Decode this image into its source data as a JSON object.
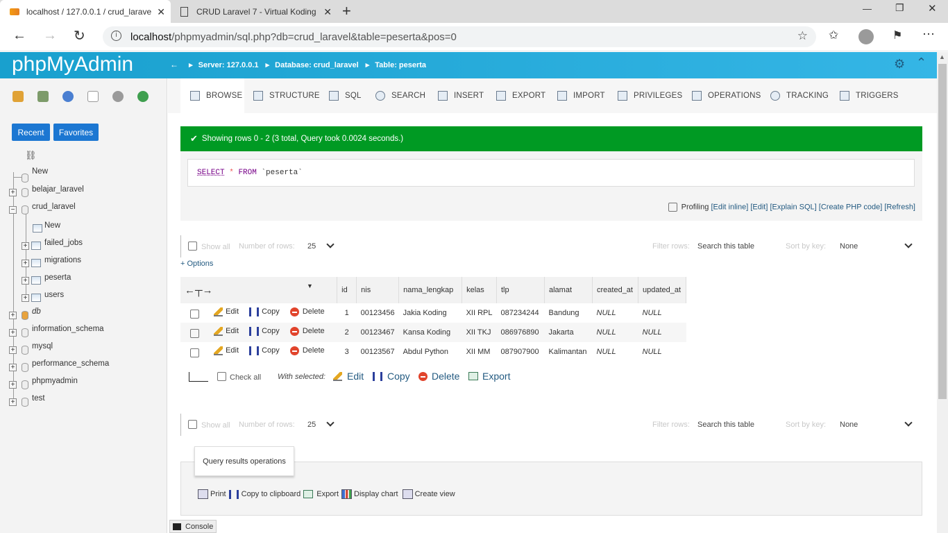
{
  "browser": {
    "tabs": [
      {
        "title": "localhost / 127.0.0.1 / crud_larave",
        "close": "✕"
      },
      {
        "title": "CRUD Laravel 7 - Virtual Koding",
        "close": "✕"
      }
    ],
    "new_tab": "+",
    "url_host": "localhost",
    "url_path": "/phpmyadmin/sql.php?db=crud_laravel&table=peserta&pos=0",
    "window_controls": [
      "—",
      "❐",
      "✕"
    ]
  },
  "pma": {
    "logo": "phpMyAdmin",
    "breadcrumb": {
      "server": "Server: 127.0.0.1",
      "database": "Database: crud_laravel",
      "table": "Table: peserta"
    }
  },
  "left": {
    "recent": "Recent",
    "favorites": "Favorites",
    "tree": [
      {
        "label": "New"
      },
      {
        "label": "belajar_laravel"
      },
      {
        "label": "crud_laravel"
      },
      {
        "label": "New"
      },
      {
        "label": "failed_jobs"
      },
      {
        "label": "migrations"
      },
      {
        "label": "peserta"
      },
      {
        "label": "users"
      },
      {
        "label": "db"
      },
      {
        "label": "information_schema"
      },
      {
        "label": "mysql"
      },
      {
        "label": "performance_schema"
      },
      {
        "label": "phpmyadmin"
      },
      {
        "label": "test"
      }
    ]
  },
  "tabs": [
    "BROWSE",
    "STRUCTURE",
    "SQL",
    "SEARCH",
    "INSERT",
    "EXPORT",
    "IMPORT",
    "PRIVILEGES",
    "OPERATIONS",
    "TRACKING",
    "TRIGGERS"
  ],
  "success": "Showing rows 0 - 2 (3 total, Query took 0.0024 seconds.)",
  "sql": {
    "select": "SELECT",
    "star": "*",
    "from": "FROM",
    "table": "`peserta`",
    "profiling": "Profiling",
    "edit_inline": "[Edit inline]",
    "edit": "[Edit]",
    "explain": "[Explain SQL]",
    "create_php": "[Create PHP code]",
    "refresh": "[Refresh]"
  },
  "nav": {
    "show_all": "Show all",
    "number_of_rows": "Number of rows:",
    "rows_value": "25",
    "filter_rows": "Filter rows:",
    "search_placeholder": "Search this table",
    "sort_by_key": "Sort by key:",
    "sort_value": "None"
  },
  "options": "+ Options",
  "table": {
    "columns": [
      "id",
      "nis",
      "nama_lengkap",
      "kelas",
      "tlp",
      "alamat",
      "created_at",
      "updated_at"
    ],
    "actions": {
      "edit": "Edit",
      "copy": "Copy",
      "delete": "Delete"
    },
    "rows": [
      [
        "1",
        "00123456",
        "Jakia Koding",
        "XII RPL",
        "087234244",
        "Bandung",
        "NULL",
        "NULL"
      ],
      [
        "2",
        "00123467",
        "Kansa Koding",
        "XII TKJ",
        "086976890",
        "Jakarta",
        "NULL",
        "NULL"
      ],
      [
        "3",
        "00123567",
        "Abdul Python",
        "XII MM",
        "087907900",
        "Kalimantan",
        "NULL",
        "NULL"
      ]
    ]
  },
  "with_selected": {
    "check_all": "Check all",
    "label": "With selected:",
    "edit": "Edit",
    "copy": "Copy",
    "delete": "Delete",
    "export": "Export"
  },
  "qro": {
    "legend": "Query results operations",
    "print": "Print",
    "copy_clipboard": "Copy to clipboard",
    "export": "Export",
    "display_chart": "Display chart",
    "create_view": "Create view"
  },
  "console": "Console",
  "colors": {
    "header": "#19a0ce",
    "success": "#009a23",
    "button": "#1c77d2",
    "link": "#235a81"
  }
}
